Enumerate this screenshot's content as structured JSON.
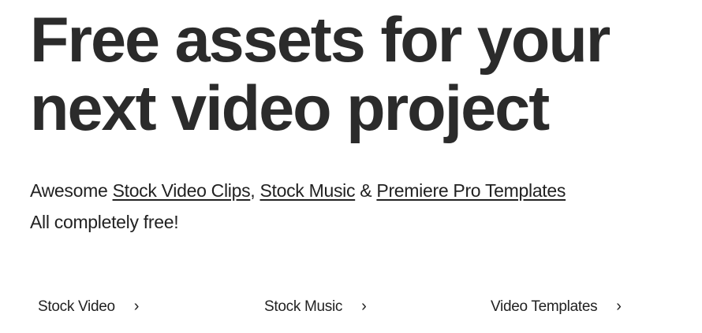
{
  "hero": {
    "title_line1": "Free assets for your",
    "title_line2": "next video project",
    "lead": "Awesome ",
    "link1": "Stock Video Clips",
    "sep1": ", ",
    "link2": "Stock Music",
    "sep2": " & ",
    "link3": "Premiere Pro Templates",
    "line2": "All completely free!"
  },
  "nav": [
    {
      "label": "Stock Video",
      "icon": "chevron-right-icon"
    },
    {
      "label": "Stock Music",
      "icon": "chevron-right-icon"
    },
    {
      "label": "Video Templates",
      "icon": "chevron-right-icon"
    }
  ]
}
